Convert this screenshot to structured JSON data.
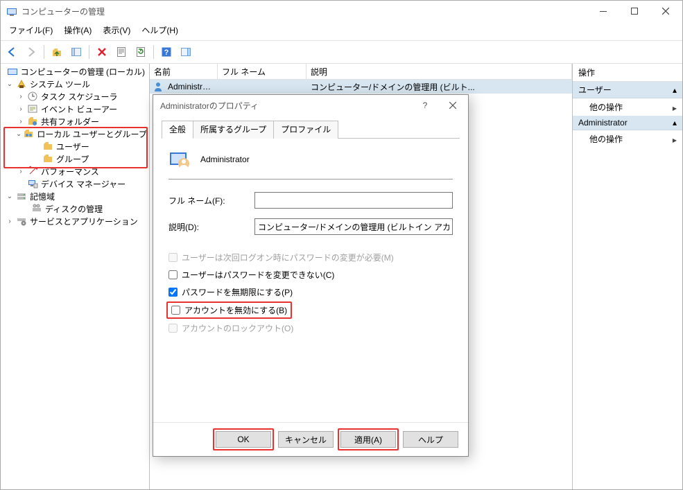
{
  "window": {
    "title": "コンピューターの管理"
  },
  "menu": {
    "file": "ファイル(F)",
    "action": "操作(A)",
    "view": "表示(V)",
    "help": "ヘルプ(H)"
  },
  "tree": {
    "root": "コンピューターの管理 (ローカル)",
    "system_tools": "システム ツール",
    "task_scheduler": "タスク スケジューラ",
    "event_viewer": "イベント ビューアー",
    "shared_folders": "共有フォルダー",
    "local_users_groups": "ローカル ユーザーとグループ",
    "users": "ユーザー",
    "groups": "グループ",
    "performance": "パフォーマンス",
    "device_manager": "デバイス マネージャー",
    "storage": "記憶域",
    "disk_mgmt": "ディスクの管理",
    "services_apps": "サービスとアプリケーション"
  },
  "list": {
    "cols": {
      "name": "名前",
      "full_name": "フル ネーム",
      "description": "説明"
    },
    "rows": [
      {
        "name": "Administrator",
        "full_name": "",
        "description": "コンピューター/ドメインの管理用 (ビルト..."
      }
    ]
  },
  "actions": {
    "title": "操作",
    "section_users": "ユーザー",
    "other_ops": "他の操作",
    "section_admin": "Administrator"
  },
  "dialog": {
    "title": "Administratorのプロパティ",
    "tabs": {
      "general": "全般",
      "member_of": "所属するグループ",
      "profile": "プロファイル"
    },
    "user_name": "Administrator",
    "labels": {
      "full_name": "フル ネーム(F):",
      "description": "説明(D):"
    },
    "fields": {
      "full_name": "",
      "description": "コンピューター/ドメインの管理用 (ビルトイン アカウント)"
    },
    "checks": {
      "must_change_pw": "ユーザーは次回ログオン時にパスワードの変更が必要(M)",
      "cannot_change_pw": "ユーザーはパスワードを変更できない(C)",
      "pw_never_expires": "パスワードを無期限にする(P)",
      "account_disabled": "アカウントを無効にする(B)",
      "account_locked": "アカウントのロックアウト(O)"
    },
    "buttons": {
      "ok": "OK",
      "cancel": "キャンセル",
      "apply": "適用(A)",
      "help": "ヘルプ"
    }
  }
}
